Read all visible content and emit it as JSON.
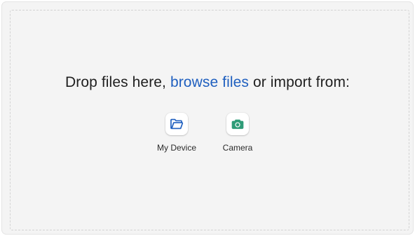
{
  "dropzone": {
    "prompt_before": "Drop files here, ",
    "browse_link": "browse files",
    "prompt_after": " or import from:"
  },
  "sources": [
    {
      "label": "My Device",
      "icon": "folder-open-icon",
      "color": "#1f5fbf"
    },
    {
      "label": "Camera",
      "icon": "camera-icon",
      "color": "#2f9c78"
    }
  ]
}
